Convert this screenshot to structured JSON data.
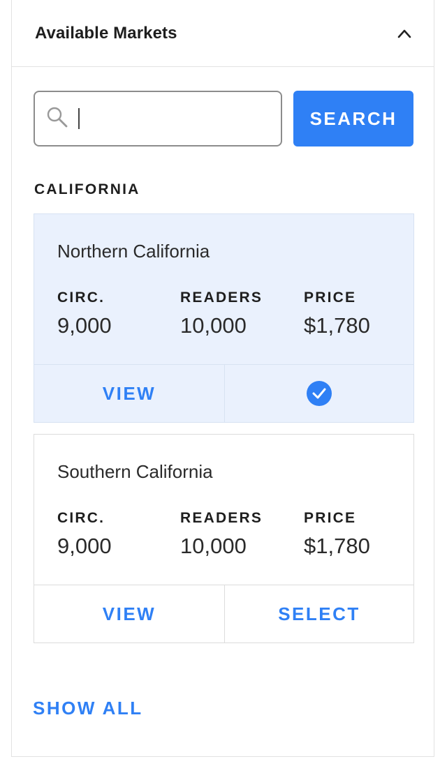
{
  "header": {
    "title": "Available Markets",
    "collapse_icon": "chevron-up-icon"
  },
  "search": {
    "value": "",
    "placeholder": "",
    "icon": "search-icon",
    "button_label": "SEARCH"
  },
  "section": {
    "label": "CALIFORNIA"
  },
  "markets": [
    {
      "name": "Northern California",
      "selected": true,
      "stats": [
        {
          "label": "CIRC.",
          "value": "9,000"
        },
        {
          "label": "READERS",
          "value": "10,000"
        },
        {
          "label": "PRICE",
          "value": "$1,780"
        }
      ],
      "view_label": "VIEW",
      "select_icon": "check-circle-icon"
    },
    {
      "name": "Southern California",
      "selected": false,
      "stats": [
        {
          "label": "CIRC.",
          "value": "9,000"
        },
        {
          "label": "READERS",
          "value": "10,000"
        },
        {
          "label": "PRICE",
          "value": "$1,780"
        }
      ],
      "view_label": "VIEW",
      "select_label": "SELECT"
    }
  ],
  "footer": {
    "show_all_label": "SHOW ALL"
  },
  "colors": {
    "accent": "#2f80f5",
    "selected_bg": "#eaf1fd"
  }
}
